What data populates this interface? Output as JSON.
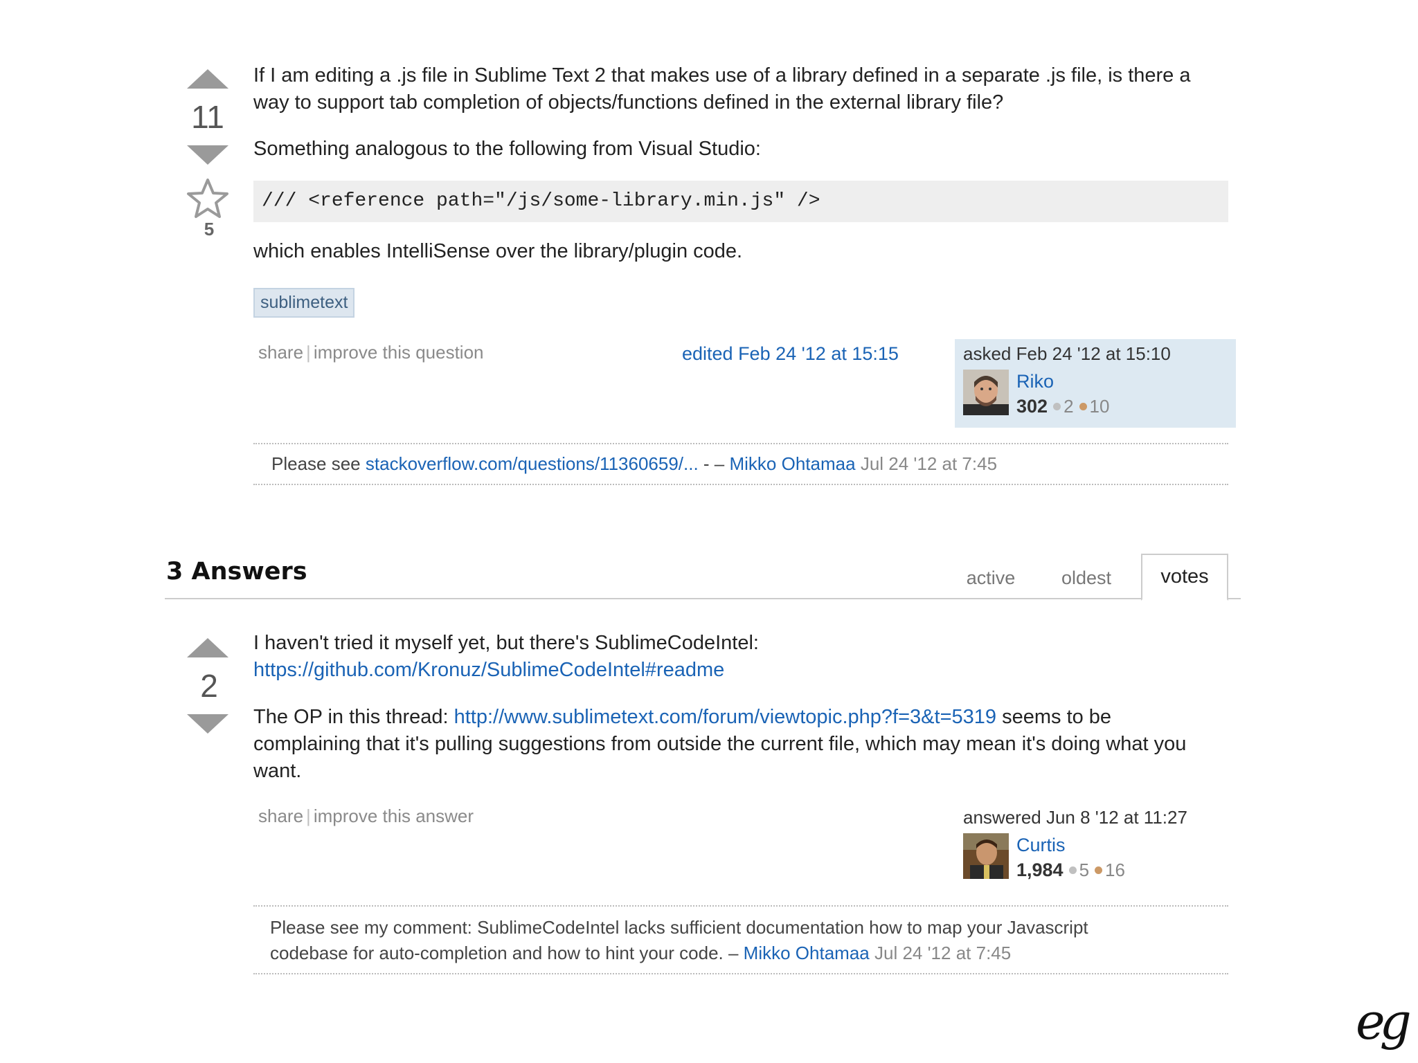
{
  "question": {
    "votes": "11",
    "favorites": "5",
    "paragraph1": "If I am editing a .js file in Sublime Text 2 that makes use of a library defined in a separate .js file, is there a way to support tab completion of objects/functions defined in the external library file?",
    "paragraph2": "Something analogous to the following from Visual Studio:",
    "code": "/// <reference path=\"/js/some-library.min.js\" />",
    "paragraph3": "which enables IntelliSense over the library/plugin code.",
    "tags": [
      "sublimetext"
    ],
    "menu": {
      "share": "share",
      "separator": "|",
      "improve": "improve this question"
    },
    "edited": "edited Feb 24 '12 at 15:15",
    "asked": "asked Feb 24 '12 at 15:10",
    "user": {
      "name": "Riko",
      "reputation": "302",
      "silver": "2",
      "bronze": "10"
    },
    "comment": {
      "prefix": "Please see",
      "link": "stackoverflow.com/questions/11360659/...",
      "dash": "- –",
      "author": "Mikko Ohtamaa",
      "date": "Jul 24 '12 at 7:45"
    }
  },
  "answers_header": {
    "title": "3 Answers",
    "tabs": [
      "active",
      "oldest",
      "votes"
    ],
    "selected_tab": "votes"
  },
  "answer": {
    "votes": "2",
    "line1": "I haven't tried it myself yet, but there's SublimeCodeIntel:",
    "link1": "https://github.com/Kronuz/SublimeCodeIntel#readme",
    "p2_prefix": "The OP in this thread:",
    "p2_link": "http://www.sublimetext.com/forum/viewtopic.php?f=3&t=5319",
    "p2_suffix_line1": "seems to be",
    "p2_line2": "complaining that it's pulling suggestions from outside the current file, which may mean it's doing what you",
    "p2_line3": "want.",
    "menu": {
      "share": "share",
      "separator": "|",
      "improve": "improve this answer"
    },
    "answered": "answered Jun 8 '12 at 11:27",
    "user": {
      "name": "Curtis",
      "reputation": "1,984",
      "silver": "5",
      "bronze": "16"
    },
    "comment": {
      "line1": "Please see my comment: SublimeCodeIntel lacks sufficient documentation how to map your Javascript",
      "line2": "codebase for auto-completion and how to hint your code. –",
      "author": "Mikko Ohtamaa",
      "date": "Jul 24 '12 at 7:45"
    }
  },
  "watermark": "eg",
  "colors": {
    "link": "#1a63b5",
    "silver_badge": "#c0c0c0",
    "bronze_badge": "#cc9966",
    "owner_card": "#dde9f2",
    "code_bg": "#eeeeee",
    "tag_bg": "#dde6ef"
  },
  "icons": [
    "vote-up-icon",
    "vote-down-icon",
    "favorite-star-icon"
  ]
}
